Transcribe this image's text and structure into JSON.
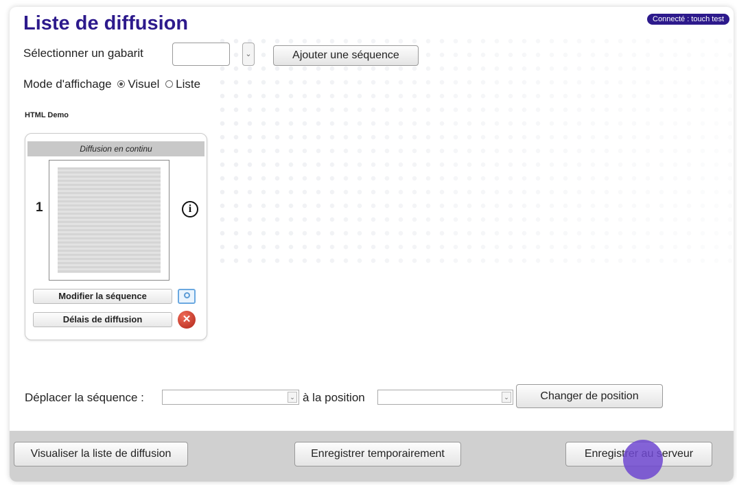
{
  "header": {
    "title": "Liste de diffusion",
    "connected": "Connecté : touch test"
  },
  "template": {
    "label": "Sélectionner un gabarit",
    "value": "",
    "add_sequence_button": "Ajouter une séquence"
  },
  "display_mode": {
    "label": "Mode d'affichage",
    "visual": "Visuel",
    "list": "Liste",
    "selected": "Visuel"
  },
  "playlist_name": "HTML Demo",
  "sequence_card": {
    "header": "Diffusion en continu",
    "number": "1",
    "modify_button": "Modifier la séquence",
    "delays_button": "Délais de diffusion"
  },
  "move": {
    "label": "Déplacer la séquence :",
    "to_label": "à la position",
    "change_button": "Changer de position"
  },
  "footer": {
    "preview_button": "Visualiser la liste de diffusion",
    "save_temp_button": "Enregistrer temporairement",
    "save_server_button": "Enregistrer au serveur"
  },
  "colors": {
    "title": "#2d1a8c",
    "badge": "#2d1a8c",
    "footer": "#d0d0d0",
    "cursor": "#6f48d0"
  }
}
